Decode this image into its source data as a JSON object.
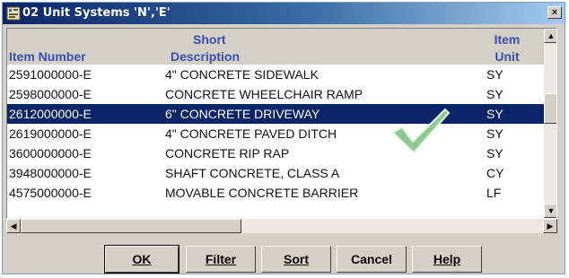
{
  "window": {
    "title": "02  Unit Systems 'N','E'",
    "close_glyph": "×"
  },
  "grid": {
    "headers": {
      "item_number": "Item Number",
      "short": "Short",
      "description": "Description",
      "unit_top": "Item",
      "unit_bottom": "Unit",
      "cut_top": "I",
      "cut_bottom": "U"
    },
    "rows": [
      {
        "item": "2591000000-E",
        "desc": "4\" CONCRETE SIDEWALK",
        "unit": "SY",
        "selected": false
      },
      {
        "item": "2598000000-E",
        "desc": "CONCRETE WHEELCHAIR RAMP",
        "unit": "SY",
        "selected": false
      },
      {
        "item": "2612000000-E",
        "desc": "6\" CONCRETE DRIVEWAY",
        "unit": "SY",
        "selected": true
      },
      {
        "item": "2619000000-E",
        "desc": "4\" CONCRETE PAVED DITCH",
        "unit": "SY",
        "selected": false
      },
      {
        "item": "3600000000-E",
        "desc": "CONCRETE RIP RAP",
        "unit": "SY",
        "selected": false
      },
      {
        "item": "3948000000-E",
        "desc": "SHAFT CONCRETE, CLASS A",
        "unit": "CY",
        "selected": false
      },
      {
        "item": "4575000000-E",
        "desc": "MOVABLE CONCRETE BARRIER",
        "unit": "LF",
        "selected": false
      }
    ]
  },
  "buttons": {
    "ok": "OK",
    "filter": "Filter",
    "sort": "Sort",
    "cancel": "Cancel",
    "help": "Help"
  },
  "icons": {
    "up": "▲",
    "down": "▼",
    "left": "◀",
    "right": "▶"
  },
  "colors": {
    "selection": "#0a246a",
    "header_text": "#3a4eb0",
    "checkmark": "#8fc98f"
  }
}
